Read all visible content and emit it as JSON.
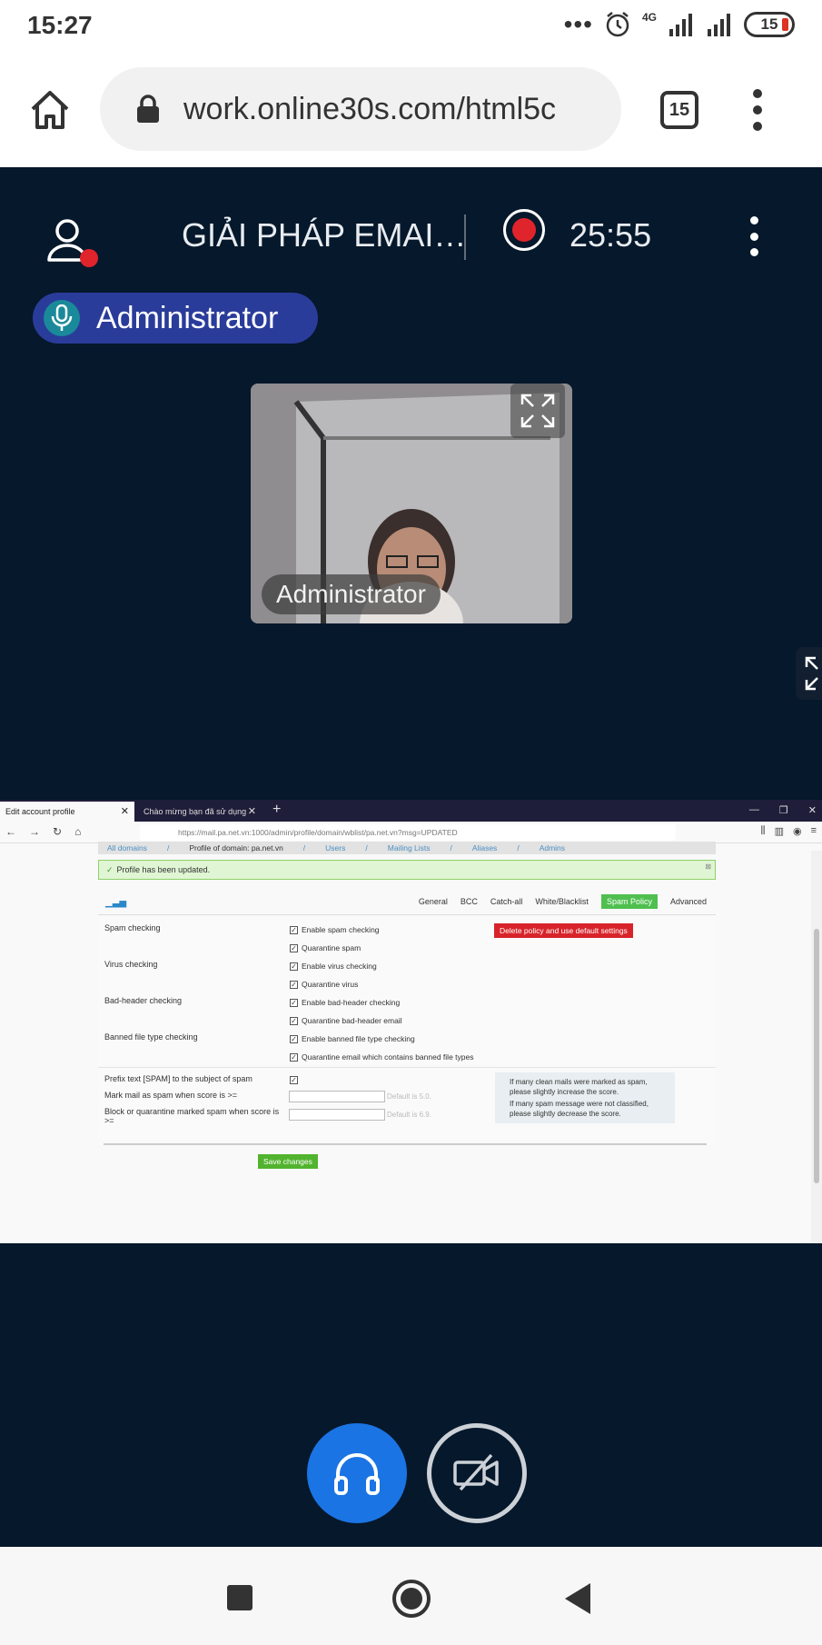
{
  "status_bar": {
    "time": "15:27",
    "network": "4G",
    "battery": "15"
  },
  "browser": {
    "url": "work.online30s.com/html5c",
    "tab_count": "15"
  },
  "meeting": {
    "title": "GIẢI PHÁP EMAI…",
    "record_time": "25:55",
    "active_speaker": "Administrator",
    "video_label": "Administrator"
  },
  "shared_screen": {
    "tabs": [
      {
        "label": "Edit account profile"
      },
      {
        "label": "Chào mừng bạn đã sử dụng"
      }
    ],
    "address": "https://mail.pa.net.vn:1000/admin/profile/domain/wblist/pa.net.vn?msg=UPDATED",
    "breadcrumbs": [
      "All domains",
      "/",
      "Profile of domain: pa.net.vn",
      "/",
      "Users",
      "/",
      "Mailing Lists",
      "/",
      "Aliases",
      "/",
      "Admins"
    ],
    "notice": "Profile has been updated.",
    "tabs_row": [
      "General",
      "BCC",
      "Catch-all",
      "White/Blacklist",
      "Spam Policy",
      "Advanced"
    ],
    "sections": {
      "spam": "Spam checking",
      "virus": "Virus checking",
      "bad_header": "Bad-header checking",
      "banned": "Banned file type checking"
    },
    "checkboxes": [
      "Enable spam checking",
      "Quarantine spam",
      "Enable virus checking",
      "Quarantine virus",
      "Enable bad-header checking",
      "Quarantine bad-header email",
      "Enable banned file type checking",
      "Quarantine email which contains banned file types"
    ],
    "delete_button": "Delete policy and use default settings",
    "prefix_label": "Prefix text [SPAM] to the subject of spam",
    "mark_label": "Mark mail as spam when score is >=",
    "block_label": "Block or quarantine marked spam when score is >=",
    "mark_hint": "Default is 5.0.",
    "block_hint": "Default is 6.9.",
    "tips": [
      "If many clean mails were marked as spam, please slightly increase the score.",
      "If many spam message were not classified, please slightly decrease the score."
    ],
    "save_button": "Save changes"
  },
  "colors": {
    "meeting_bg": "#06182b",
    "speaker_pill": "#2a3c9a",
    "record_red": "#e0242b",
    "audio_blue": "#1b74e4",
    "active_tab_green": "#4fbf4f",
    "delete_red": "#d8232a"
  }
}
